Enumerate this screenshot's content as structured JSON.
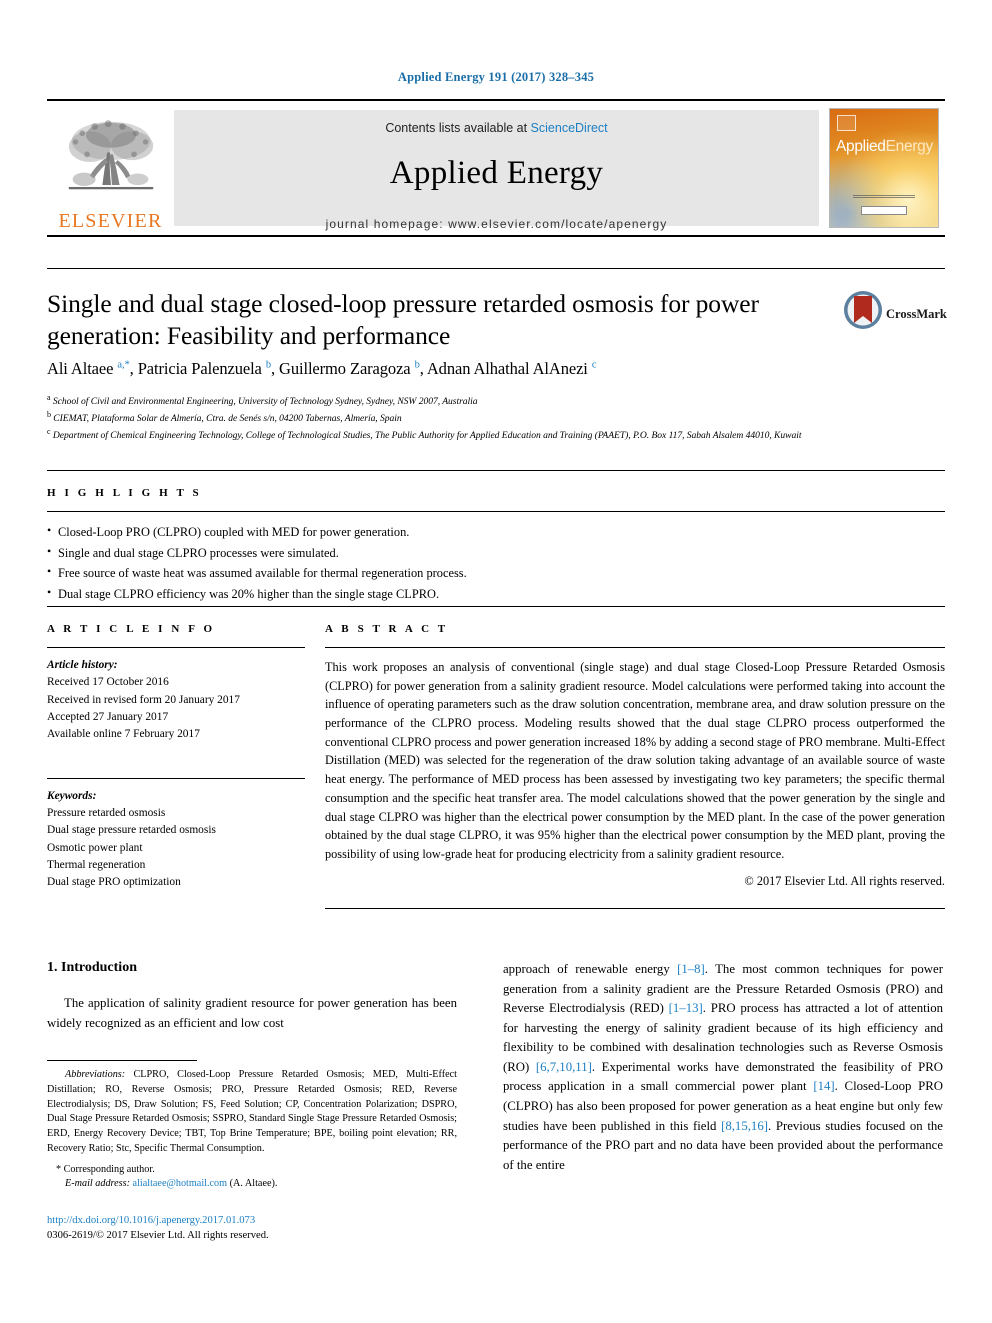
{
  "journal_ref": "Applied Energy 191 (2017) 328–345",
  "masthead": {
    "publisher_logo_label": "ELSEVIER",
    "contents_prefix": "Contents lists available at ",
    "contents_link": "ScienceDirect",
    "journal_title": "Applied Energy",
    "homepage": "journal homepage: www.elsevier.com/locate/apenergy",
    "cover": {
      "title_part1": "Applied",
      "title_part2": "Energy"
    }
  },
  "article": {
    "title": "Single and dual stage closed-loop pressure retarded osmosis for power generation: Feasibility and performance",
    "crossmark_label": "CrossMark",
    "authors_html": "Ali Altaee <sup>a,*</sup>, Patricia Palenzuela <sup>b</sup>, Guillermo Zaragoza <sup>b</sup>, Adnan Alhathal AlAnezi <sup>c</sup>",
    "affiliations": [
      "<sup>a</sup> School of Civil and Environmental Engineering, University of Technology Sydney, Sydney, NSW 2007, Australia",
      "<sup>b</sup> CIEMAT, Plataforma Solar de Almería, Ctra. de Senés s/n, 04200 Tabernas, Almería, Spain",
      "<sup>c</sup> Department of Chemical Engineering Technology, College of Technological Studies, The Public Authority for Applied Education and Training (PAAET), P.O. Box 117, Sabah Alsalem 44010, Kuwait"
    ]
  },
  "highlights": {
    "heading": "H I G H L I G H T S",
    "items": [
      "Closed-Loop PRO (CLPRO) coupled with MED for power generation.",
      "Single and dual stage CLPRO processes were simulated.",
      "Free source of waste heat was assumed available for thermal regeneration process.",
      "Dual stage CLPRO efficiency was 20% higher than the single stage CLPRO."
    ]
  },
  "article_info": {
    "heading": "A R T I C L E   I N F O",
    "history_label": "Article history:",
    "history": [
      "Received 17 October 2016",
      "Received in revised form 20 January 2017",
      "Accepted 27 January 2017",
      "Available online 7 February 2017"
    ],
    "keywords_label": "Keywords:",
    "keywords": [
      "Pressure retarded osmosis",
      "Dual stage pressure retarded osmosis",
      "Osmotic power plant",
      "Thermal regeneration",
      "Dual stage PRO optimization"
    ]
  },
  "abstract": {
    "heading": "A B S T R A C T",
    "text": "This work proposes an analysis of conventional (single stage) and dual stage Closed-Loop Pressure Retarded Osmosis (CLPRO) for power generation from a salinity gradient resource. Model calculations were performed taking into account the influence of operating parameters such as the draw solution concentration, membrane area, and draw solution pressure on the performance of the CLPRO process. Modeling results showed that the dual stage CLPRO process outperformed the conventional CLPRO process and power generation increased 18% by adding a second stage of PRO membrane. Multi-Effect Distillation (MED) was selected for the regeneration of the draw solution taking advantage of an available source of waste heat energy. The performance of MED process has been assessed by investigating two key parameters; the specific thermal consumption and the specific heat transfer area. The model calculations showed that the power generation by the single and dual stage CLPRO was higher than the electrical power consumption by the MED plant. In the case of the power generation obtained by the dual stage CLPRO, it was 95% higher than the electrical power consumption by the MED plant, proving the possibility of using low-grade heat for producing electricity from a salinity gradient resource.",
    "copyright": "© 2017 Elsevier Ltd. All rights reserved."
  },
  "body": {
    "section_number_title": "1. Introduction",
    "left_paragraph": "The application of salinity gradient resource for power generation has been widely recognized as an efficient and low cost",
    "right_paragraph_html": "approach of renewable energy <span class=\"cite\">[1–8]</span>. The most common techniques for power generation from a salinity gradient are the Pressure Retarded Osmosis (PRO) and Reverse Electrodialysis (RED) <span class=\"cite\">[1–13]</span>. PRO process has attracted a lot of attention for harvesting the energy of salinity gradient because of its high efficiency and flexibility to be combined with desalination technologies such as Reverse Osmosis (RO) <span class=\"cite\">[6,7,10,11]</span>. Experimental works have demonstrated the feasibility of PRO process application in a small commercial power plant <span class=\"cite\">[14]</span>. Closed-Loop PRO (CLPRO) has also been proposed for power generation as a heat engine but only few studies have been published in this field <span class=\"cite\">[8,15,16]</span>. Previous studies focused on the performance of the PRO part and no data have been provided about the performance of the entire"
  },
  "footnote": {
    "abbreviations_label": "Abbreviations:",
    "abbreviations_text": "CLPRO, Closed-Loop Pressure Retarded Osmosis; MED, Multi-Effect Distillation; RO, Reverse Osmosis; PRO, Pressure Retarded Osmosis; RED, Reverse Electrodialysis; DS, Draw Solution; FS, Feed Solution; CP, Concentration Polarization; DSPRO, Dual Stage Pressure Retarded Osmosis; SSPRO, Standard Single Stage Pressure Retarded Osmosis; ERD, Energy Recovery Device; TBT, Top Brine Temperature; BPE, boiling point elevation; RR, Recovery Ratio; Stc, Specific Thermal Consumption.",
    "corresponding_author": "* Corresponding author.",
    "email_label": "E-mail address:",
    "email": "alialtaee@hotmail.com",
    "email_owner": "(A. Altaee)."
  },
  "publication_footer": {
    "doi_url": "http://dx.doi.org/10.1016/j.apenergy.2017.01.073",
    "issn_line": "0306-2619/© 2017 Elsevier Ltd. All rights reserved."
  },
  "colors": {
    "link_blue": "#1b7fc4",
    "elsevier_orange": "#e87722",
    "crossmark_red": "#b02a1e",
    "crossmark_blue": "#5b7f9e"
  }
}
